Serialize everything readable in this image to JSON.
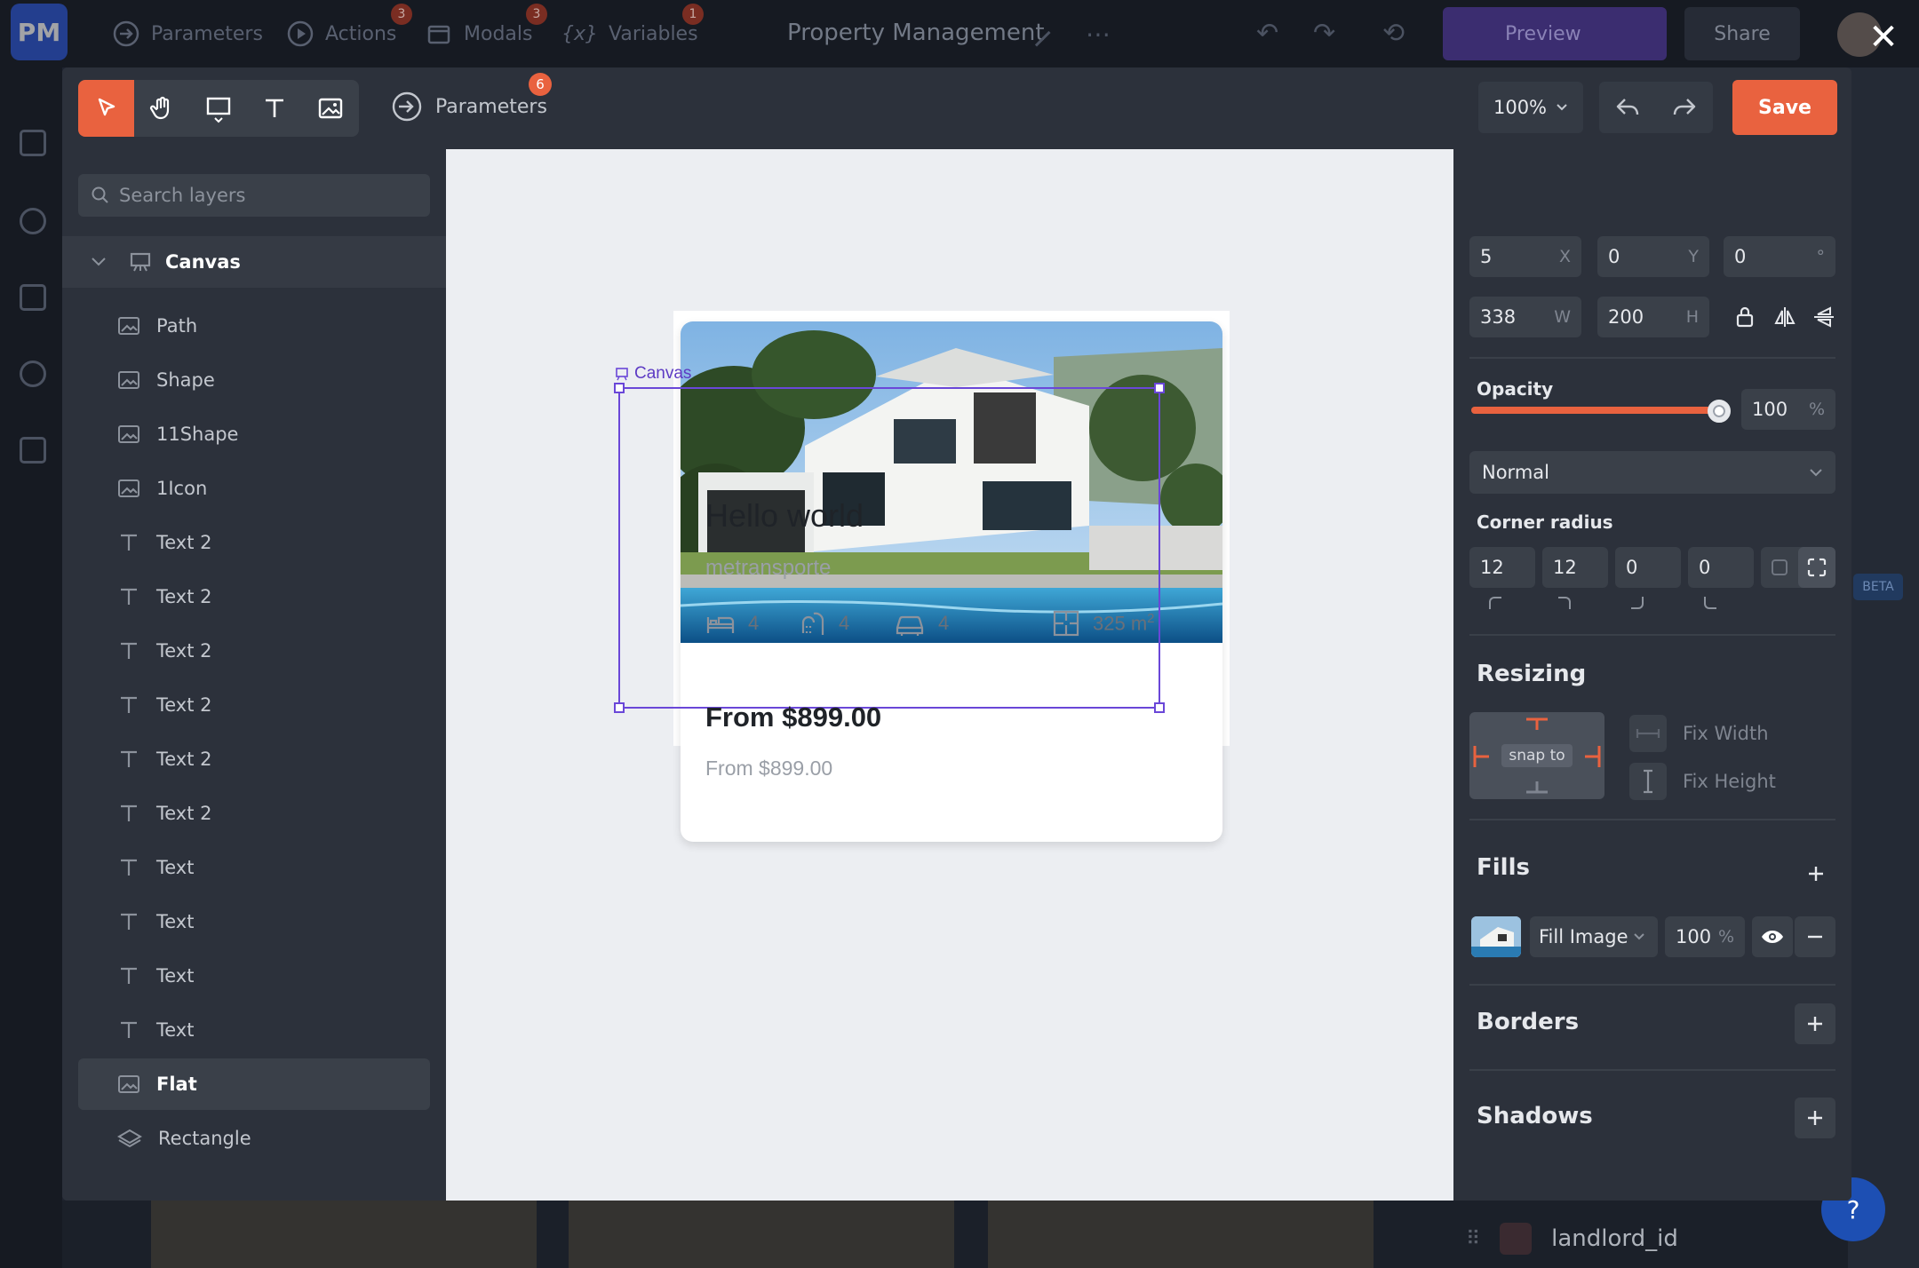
{
  "background_app": {
    "logo": "PM",
    "tabs": [
      {
        "label": "Parameters",
        "badge": ""
      },
      {
        "label": "Actions",
        "badge": "3"
      },
      {
        "label": "Modals",
        "badge": "3"
      },
      {
        "label": "Variables",
        "badge": "1"
      }
    ],
    "project_title": "Property Management",
    "preview_label": "Preview",
    "share_label": "Share",
    "beta_label": "BETA",
    "bottom_field": "landlord_id",
    "help_label": "?"
  },
  "toolbar": {
    "tools": [
      "select-tool",
      "hand-tool",
      "rectangle-tool",
      "text-tool",
      "image-tool"
    ],
    "active_tool": "select-tool",
    "parameters_label": "Parameters",
    "parameters_badge": "6",
    "zoom": "100%",
    "save_label": "Save"
  },
  "layers": {
    "search_placeholder": "Search layers",
    "root": "Canvas",
    "items": [
      {
        "label": "Path",
        "icon": "image-icon"
      },
      {
        "label": "Shape",
        "icon": "image-icon"
      },
      {
        "label": "11Shape",
        "icon": "image-icon"
      },
      {
        "label": "1Icon",
        "icon": "image-icon"
      },
      {
        "label": "Text 2",
        "icon": "text-icon"
      },
      {
        "label": "Text 2",
        "icon": "text-icon"
      },
      {
        "label": "Text 2",
        "icon": "text-icon"
      },
      {
        "label": "Text 2",
        "icon": "text-icon"
      },
      {
        "label": "Text 2",
        "icon": "text-icon"
      },
      {
        "label": "Text 2",
        "icon": "text-icon"
      },
      {
        "label": "Text",
        "icon": "text-icon"
      },
      {
        "label": "Text",
        "icon": "text-icon"
      },
      {
        "label": "Text",
        "icon": "text-icon"
      },
      {
        "label": "Text",
        "icon": "text-icon"
      },
      {
        "label": "Flat",
        "icon": "image-icon",
        "selected": true
      },
      {
        "label": "Rectangle",
        "icon": "layers-icon"
      }
    ]
  },
  "canvas": {
    "selection_label": "Canvas",
    "card": {
      "title": "Hello world",
      "subtitle": "metransporte",
      "features": [
        {
          "icon": "bed-icon",
          "value": "4"
        },
        {
          "icon": "shower-icon",
          "value": "4"
        },
        {
          "icon": "car-icon",
          "value": "4"
        }
      ],
      "area_value": "325 m",
      "area_sup": "2",
      "price": "From $899.00",
      "price_secondary": "From $899.00"
    }
  },
  "properties": {
    "x": {
      "value": "5",
      "unit": "X"
    },
    "y": {
      "value": "0",
      "unit": "Y"
    },
    "rotation": {
      "value": "0",
      "unit": "°"
    },
    "width": {
      "value": "338",
      "unit": "W"
    },
    "height": {
      "value": "200",
      "unit": "H"
    },
    "opacity_label": "Opacity",
    "opacity_value": "100",
    "opacity_unit": "%",
    "opacity_level": 1.0,
    "blend_mode": "Normal",
    "corner_radius_label": "Corner radius",
    "corner_radius": [
      "12",
      "12",
      "0",
      "0"
    ],
    "resizing_label": "Resizing",
    "snap_label": "snap to",
    "fix_width_label": "Fix Width",
    "fix_height_label": "Fix Height",
    "fills_label": "Fills",
    "fill_type": "Fill Image",
    "fill_opacity": "100",
    "fill_unit": "%",
    "borders_label": "Borders",
    "shadows_label": "Shadows"
  },
  "colors": {
    "accent": "#e9623f",
    "selection": "#6a47d8",
    "panel": "#2c313b",
    "field": "#3a4049"
  }
}
